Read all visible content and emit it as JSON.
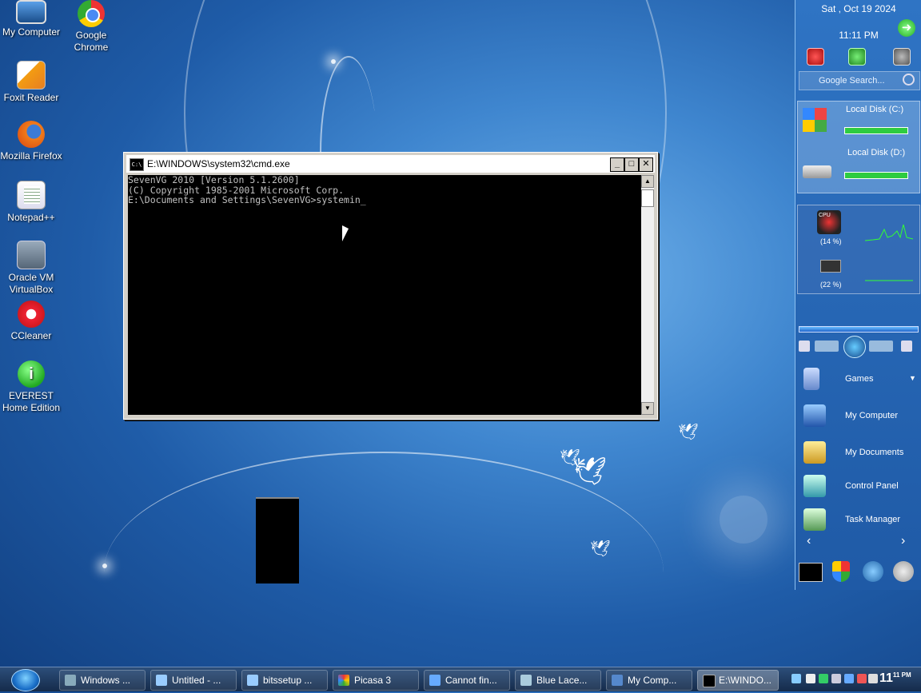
{
  "desktop": {
    "icons": [
      {
        "label": "My Computer"
      },
      {
        "label": "Google Chrome"
      },
      {
        "label": "Foxit Reader"
      },
      {
        "label": "Mozilla Firefox"
      },
      {
        "label": "Notepad++"
      },
      {
        "label": "Oracle VM VirtualBox"
      },
      {
        "label": "CCleaner"
      },
      {
        "label": "EVEREST Home Edition"
      }
    ]
  },
  "cmd": {
    "title": "E:\\WINDOWS\\system32\\cmd.exe",
    "icon_text": "C:\\",
    "minimize": "_",
    "maximize": "□",
    "close": "✕",
    "lines": [
      "SevenVG 2010 [Version 5.1.2600]",
      "(C) Copyright 1985-2001 Microsoft Corp.",
      "",
      "E:\\Documents and Settings\\SevenVG>systemin_"
    ],
    "scroll_up": "▲",
    "scroll_down": "▼"
  },
  "sidebar": {
    "date": "Sat , Oct 19 2024",
    "time": "11:11 PM",
    "search_placeholder": "Google Search...",
    "disks": [
      {
        "label": "Local Disk (C:)",
        "used_fraction": 0.92
      },
      {
        "label": "Local Disk (D:)",
        "used_fraction": 0.92
      }
    ],
    "cpu_label": "CPU",
    "cpu_percent": "(14 %)",
    "ram_percent": "(22 %)",
    "menu": [
      {
        "label": "Games"
      },
      {
        "label": "My Computer"
      },
      {
        "label": "My Documents"
      },
      {
        "label": "Control Panel"
      },
      {
        "label": "Task Manager"
      }
    ],
    "prev": "‹",
    "next": "›",
    "dropdown": "▼"
  },
  "taskbar": {
    "tasks": [
      {
        "label": "Windows ..."
      },
      {
        "label": "Untitled - ..."
      },
      {
        "label": "bitssetup ..."
      },
      {
        "label": "Picasa 3"
      },
      {
        "label": "Cannot fin..."
      },
      {
        "label": "Blue Lace..."
      },
      {
        "label": "My Comp..."
      },
      {
        "label": "E:\\WINDO..."
      }
    ],
    "clock": "11",
    "clock_sup": "11 PM"
  },
  "colors": {
    "accent": "#2f74c4",
    "disk_bar": "#2ecc40",
    "cmd_bg": "#000000",
    "cmd_text": "#c0c0c0"
  }
}
